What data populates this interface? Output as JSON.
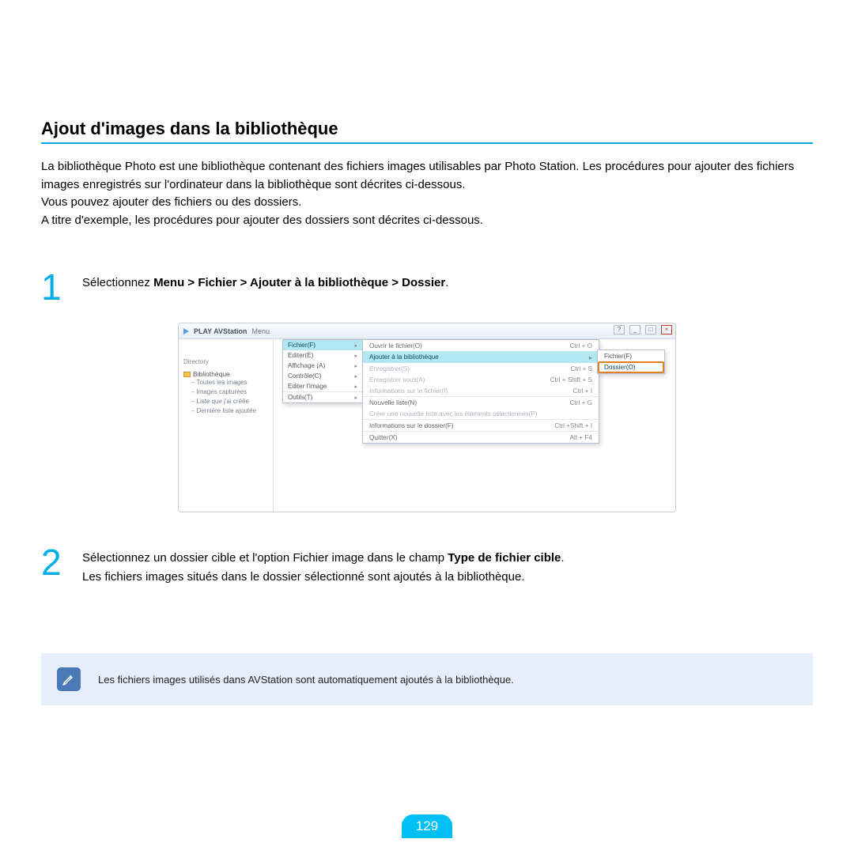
{
  "title": "Ajout d'images dans la bibliothèque",
  "intro": {
    "p1": "La bibliothèque Photo est une bibliothèque contenant des fichiers images utilisables par Photo Station. Les procédures pour ajouter des fichiers images enregistrés sur l'ordinateur dans la bibliothèque sont décrites ci-dessous.",
    "p2": "Vous pouvez ajouter des fichiers ou des dossiers.",
    "p3": "A titre d'exemple, les procédures pour ajouter des dossiers sont décrites ci-dessous."
  },
  "step1": {
    "num": "1",
    "pre": "Sélectionnez ",
    "bold": "Menu > Fichier > Ajouter à la bibliothèque > Dossier",
    "post": "."
  },
  "shot": {
    "app_title": "PLAY AVStation",
    "app_menu": "Menu",
    "sidebar": {
      "label": "Directory",
      "root": "Bibliothèque",
      "items": [
        "Toutes les images",
        "Images capturées",
        "Liste que j'ai créée",
        "Dernière liste ajoutée"
      ]
    },
    "menu1": [
      {
        "label": "Fichier(F)",
        "hi": true
      },
      {
        "label": "Editer(E)"
      },
      {
        "label": "Affichage (A)"
      },
      {
        "label": "Contrôle(C)"
      },
      {
        "label": "Editer l'image"
      },
      {
        "label": "Outils(T)"
      }
    ],
    "menu2": [
      {
        "label": "Ouvrir le fichier(O)",
        "sc": "Ctrl + O"
      },
      {
        "label": "Ajouter à la bibliothèque",
        "sc": "▸",
        "hi": true
      },
      {
        "label": "Enregistrer(S)",
        "sc": "Ctrl + S",
        "dim": true
      },
      {
        "label": "Enregistrer sous(A)",
        "sc": "Ctrl + Shift + S",
        "dim": true
      },
      {
        "label": "Informations sur le fichier(I)",
        "sc": "Ctrl + I",
        "dim": true
      },
      {
        "label": "Nouvelle liste(N)",
        "sc": "Ctrl + G",
        "sep": true
      },
      {
        "label": "Créer une nouvelle liste avec les éléments sélectionnés(P)",
        "sc": "",
        "dim": true
      },
      {
        "label": "Informations sur le dossier(F)",
        "sc": "Ctrl +Shift + I",
        "sep": true
      },
      {
        "label": "Quitter(X)",
        "sc": "Alt + F4",
        "sep": true
      }
    ],
    "menu3": [
      {
        "label": "Fichier(F)"
      },
      {
        "label": "Dossier(O)",
        "hi": true
      }
    ]
  },
  "step2": {
    "num": "2",
    "pre": "Sélectionnez un dossier cible et l'option Fichier image dans le champ ",
    "bold": "Type de fichier cible",
    "post1": ".",
    "line2": "Les fichiers images situés dans le dossier sélectionné sont ajoutés à la bibliothèque."
  },
  "note": "Les fichiers images utilisés dans AVStation sont automatiquement ajoutés à la bibliothèque.",
  "page_number": "129"
}
